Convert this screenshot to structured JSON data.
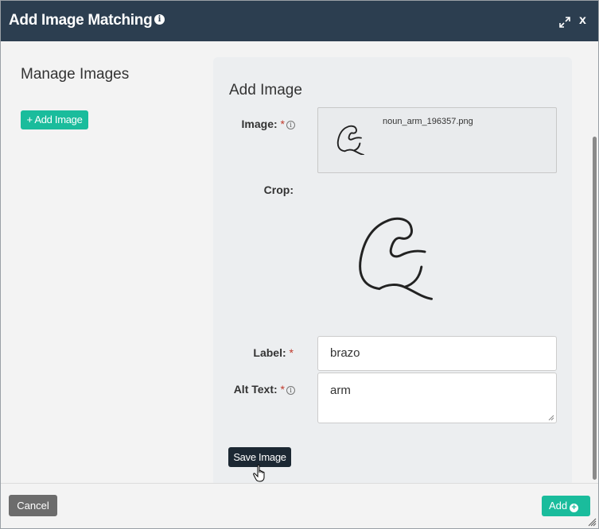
{
  "dialog": {
    "title": "Add Image Matching",
    "info_icon": "info-icon",
    "expand_icon": "expand-icon",
    "close_label": "x"
  },
  "sidebar": {
    "title": "Manage Images",
    "add_button": "+ Add Image"
  },
  "form": {
    "title": "Add Image",
    "image_label": "Image:",
    "required_mark": "*",
    "image_filename": "noun_arm_196357.png",
    "crop_label": "Crop:",
    "label_label": "Label:",
    "label_value": "brazo",
    "alt_label": "Alt Text:",
    "alt_value": "arm",
    "save_button": "Save Image"
  },
  "footer": {
    "cancel_button": "Cancel",
    "add_button": "Add"
  },
  "colors": {
    "titlebar": "#2c3e50",
    "accent": "#1abc9c",
    "required": "#c0392b"
  }
}
